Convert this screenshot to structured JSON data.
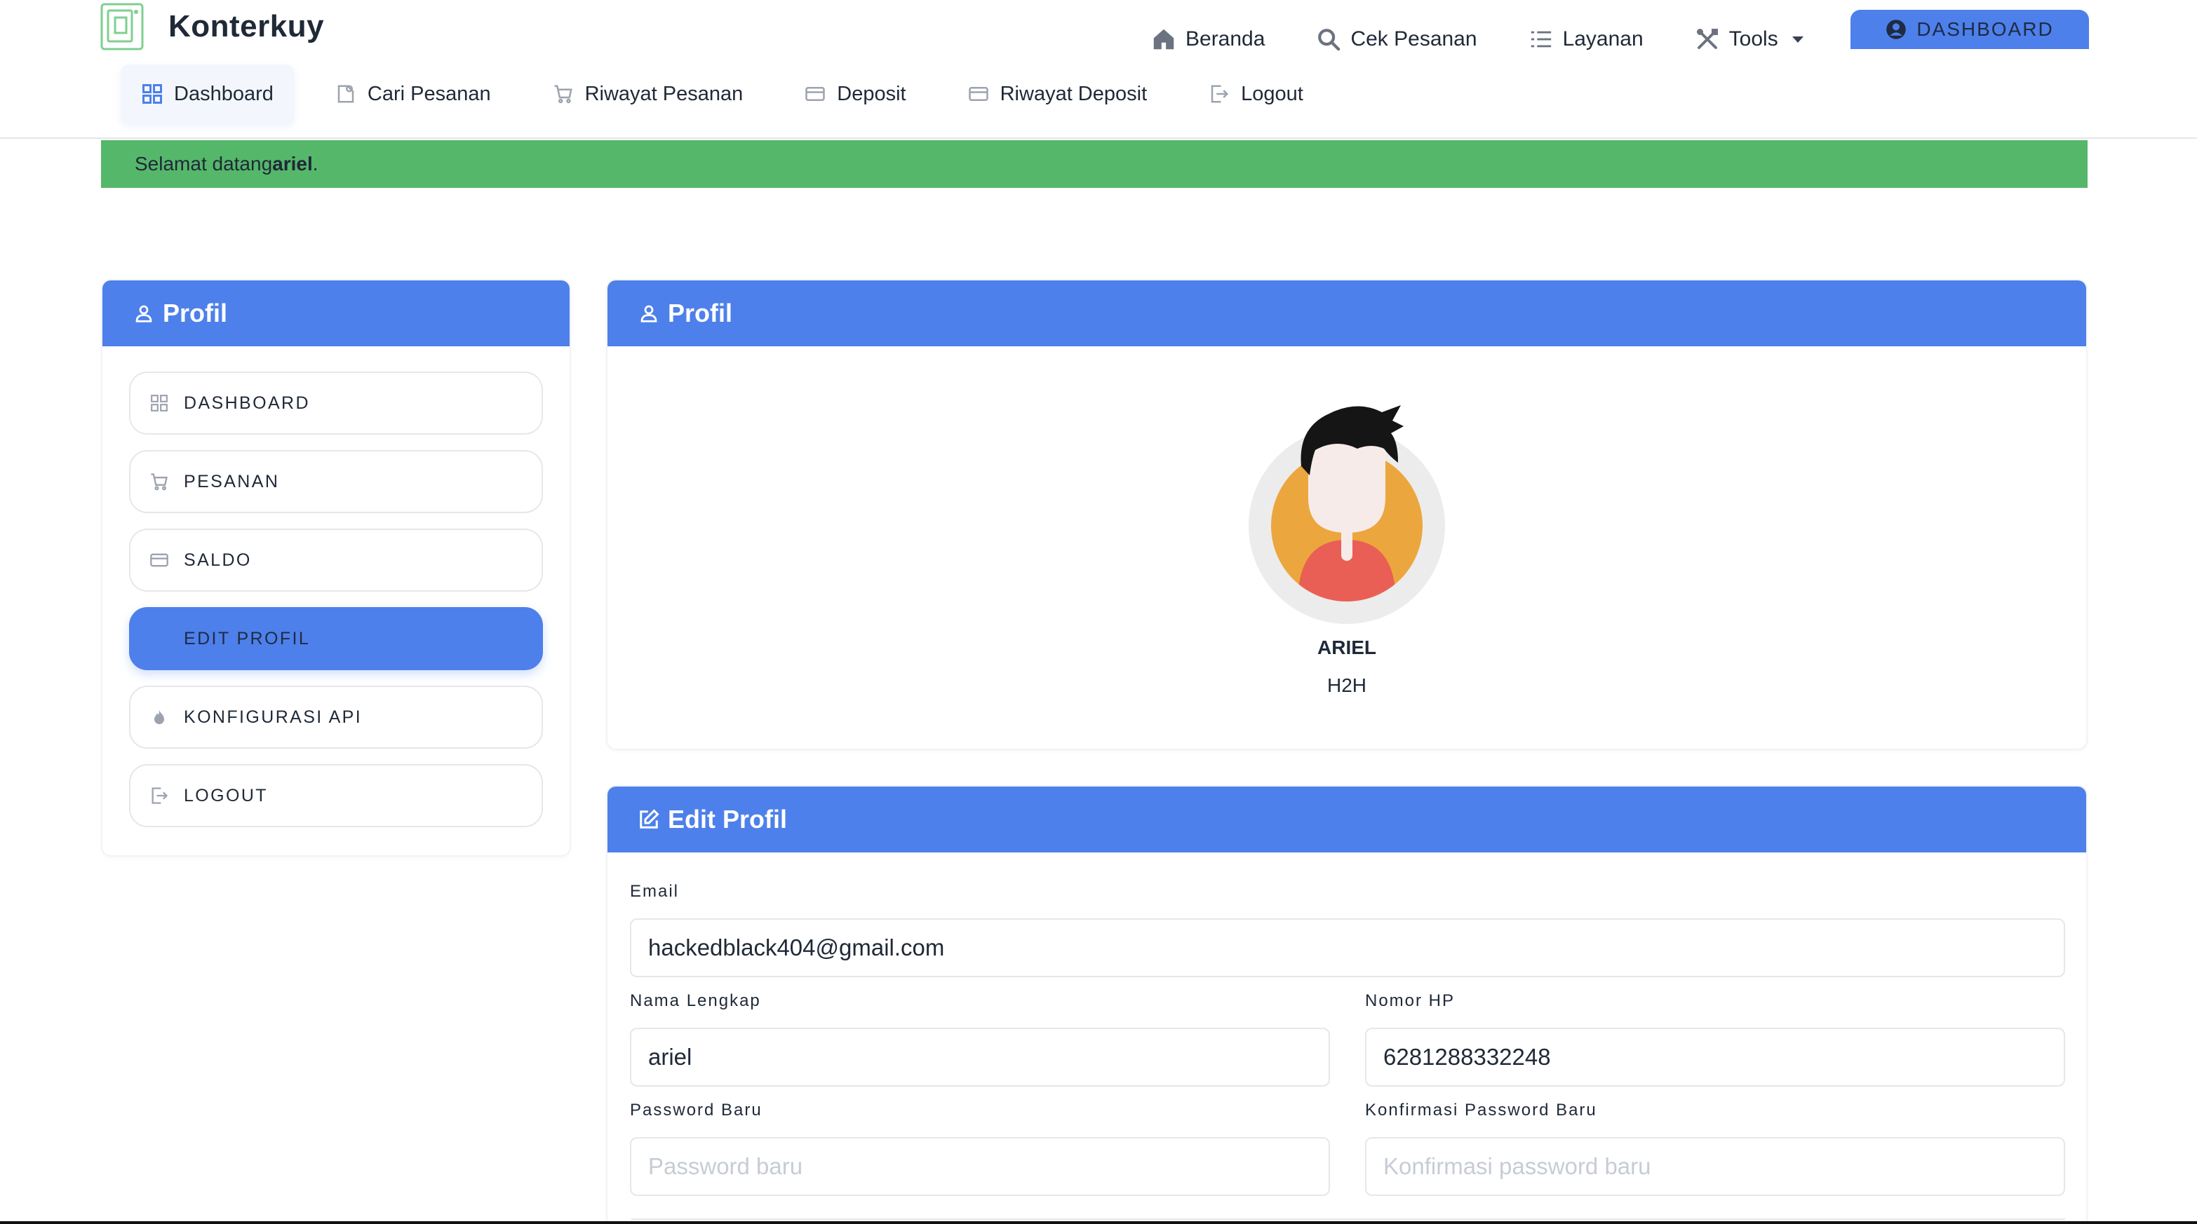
{
  "brand": {
    "name": "Konterkuy"
  },
  "topnav": {
    "items": [
      {
        "label": "Beranda",
        "icon": "home-icon"
      },
      {
        "label": "Cek Pesanan",
        "icon": "search-icon"
      },
      {
        "label": "Layanan",
        "icon": "list-icon"
      },
      {
        "label": "Tools",
        "icon": "tools-icon"
      }
    ],
    "dashboard_button": "DASHBOARD"
  },
  "subnav": {
    "items": [
      {
        "label": "Dashboard",
        "icon": "grid-icon",
        "active": true
      },
      {
        "label": "Cari Pesanan",
        "icon": "search-document-icon"
      },
      {
        "label": "Riwayat Pesanan",
        "icon": "cart-icon"
      },
      {
        "label": "Deposit",
        "icon": "credit-card-icon"
      },
      {
        "label": "Riwayat Deposit",
        "icon": "credit-card-icon"
      },
      {
        "label": "Logout",
        "icon": "logout-icon"
      }
    ]
  },
  "alert": {
    "prefix": "Selamat datang ",
    "user": "ariel",
    "suffix": "."
  },
  "left_card": {
    "title": "Profil",
    "menu": [
      {
        "label": "DASHBOARD",
        "icon": "grid-icon"
      },
      {
        "label": "PESANAN",
        "icon": "cart-icon"
      },
      {
        "label": "SALDO",
        "icon": "credit-card-icon"
      },
      {
        "label": "EDIT PROFIL",
        "icon": "",
        "active": true
      },
      {
        "label": "KONFIGURASI API",
        "icon": "fire-icon"
      },
      {
        "label": "LOGOUT",
        "icon": "logout-icon"
      }
    ]
  },
  "profile_card": {
    "title": "Profil",
    "name": "ARIEL",
    "role": "H2H"
  },
  "edit_card": {
    "title": "Edit Profil",
    "email_label": "Email",
    "email_value": "hackedblack404@gmail.com",
    "fullname_label": "Nama Lengkap",
    "fullname_value": "ariel",
    "phone_label": "Nomor HP",
    "phone_value": "6281288332248",
    "password_label": "Password Baru",
    "password_placeholder": "Password baru",
    "confirm_label": "Konfirmasi Password Baru",
    "confirm_placeholder": "Konfirmasi password baru"
  },
  "colors": {
    "primary": "#4d80ea",
    "success": "#55b76a"
  }
}
